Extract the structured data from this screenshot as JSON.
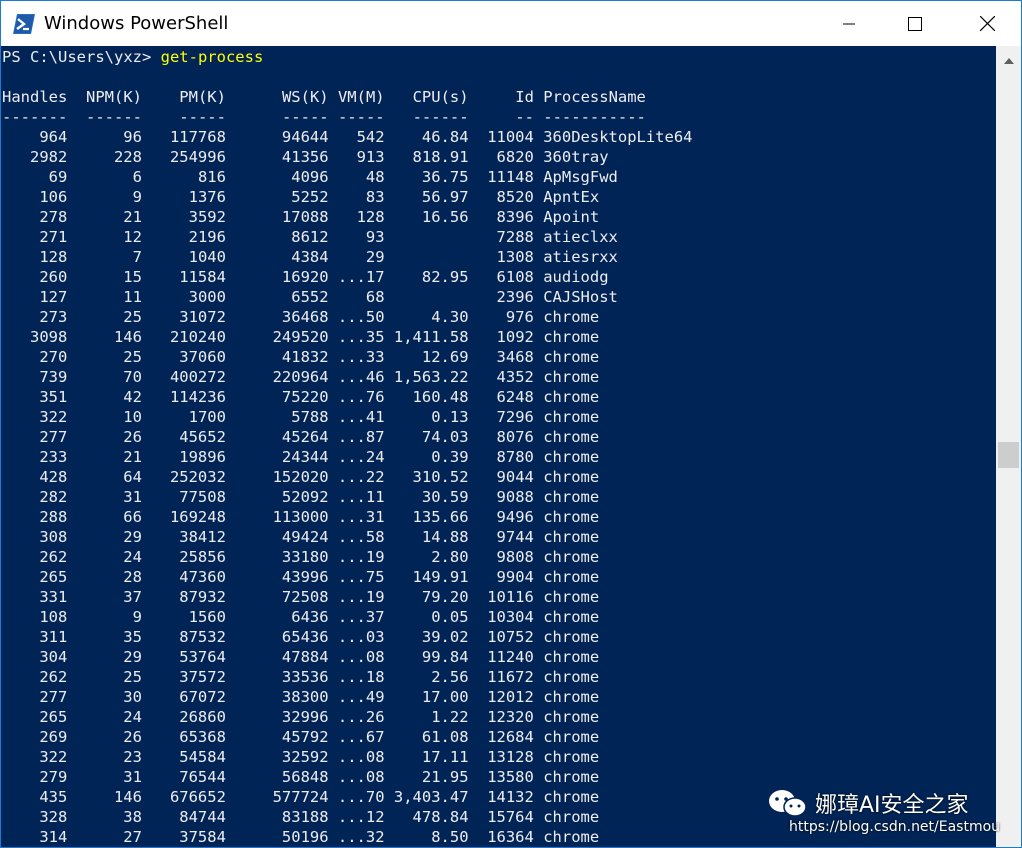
{
  "window": {
    "title": "Windows PowerShell",
    "controls": {
      "minimize": "minimize-icon",
      "maximize": "maximize-icon",
      "close": "close-icon"
    }
  },
  "console": {
    "prompt": "PS C:\\Users\\yxz> ",
    "command": "get-process",
    "header": "Handles  NPM(K)    PM(K)      WS(K) VM(M)   CPU(s)     Id ProcessName",
    "separator": "-------  ------    -----      ----- -----   ------     -- -----------",
    "rows": [
      {
        "handles": "964",
        "npm": "96",
        "pm": "117768",
        "ws": "94644",
        "vm": "542",
        "cpu": "46.84",
        "id": "11004",
        "name": "360DesktopLite64"
      },
      {
        "handles": "2982",
        "npm": "228",
        "pm": "254996",
        "ws": "41356",
        "vm": "913",
        "cpu": "818.91",
        "id": "6820",
        "name": "360tray"
      },
      {
        "handles": "69",
        "npm": "6",
        "pm": "816",
        "ws": "4096",
        "vm": "48",
        "cpu": "36.75",
        "id": "11148",
        "name": "ApMsgFwd"
      },
      {
        "handles": "106",
        "npm": "9",
        "pm": "1376",
        "ws": "5252",
        "vm": "83",
        "cpu": "56.97",
        "id": "8520",
        "name": "ApntEx"
      },
      {
        "handles": "278",
        "npm": "21",
        "pm": "3592",
        "ws": "17088",
        "vm": "128",
        "cpu": "16.56",
        "id": "8396",
        "name": "Apoint"
      },
      {
        "handles": "271",
        "npm": "12",
        "pm": "2196",
        "ws": "8612",
        "vm": "93",
        "cpu": "",
        "id": "7288",
        "name": "atieclxx"
      },
      {
        "handles": "128",
        "npm": "7",
        "pm": "1040",
        "ws": "4384",
        "vm": "29",
        "cpu": "",
        "id": "1308",
        "name": "atiesrxx"
      },
      {
        "handles": "260",
        "npm": "15",
        "pm": "11584",
        "ws": "16920",
        "vm": "...17",
        "cpu": "82.95",
        "id": "6108",
        "name": "audiodg"
      },
      {
        "handles": "127",
        "npm": "11",
        "pm": "3000",
        "ws": "6552",
        "vm": "68",
        "cpu": "",
        "id": "2396",
        "name": "CAJSHost"
      },
      {
        "handles": "273",
        "npm": "25",
        "pm": "31072",
        "ws": "36468",
        "vm": "...50",
        "cpu": "4.30",
        "id": "976",
        "name": "chrome"
      },
      {
        "handles": "3098",
        "npm": "146",
        "pm": "210240",
        "ws": "249520",
        "vm": "...35",
        "cpu": "1,411.58",
        "id": "1092",
        "name": "chrome"
      },
      {
        "handles": "270",
        "npm": "25",
        "pm": "37060",
        "ws": "41832",
        "vm": "...33",
        "cpu": "12.69",
        "id": "3468",
        "name": "chrome"
      },
      {
        "handles": "739",
        "npm": "70",
        "pm": "400272",
        "ws": "220964",
        "vm": "...46",
        "cpu": "1,563.22",
        "id": "4352",
        "name": "chrome"
      },
      {
        "handles": "351",
        "npm": "42",
        "pm": "114236",
        "ws": "75220",
        "vm": "...76",
        "cpu": "160.48",
        "id": "6248",
        "name": "chrome"
      },
      {
        "handles": "322",
        "npm": "10",
        "pm": "1700",
        "ws": "5788",
        "vm": "...41",
        "cpu": "0.13",
        "id": "7296",
        "name": "chrome"
      },
      {
        "handles": "277",
        "npm": "26",
        "pm": "45652",
        "ws": "45264",
        "vm": "...87",
        "cpu": "74.03",
        "id": "8076",
        "name": "chrome"
      },
      {
        "handles": "233",
        "npm": "21",
        "pm": "19896",
        "ws": "24344",
        "vm": "...24",
        "cpu": "0.39",
        "id": "8780",
        "name": "chrome"
      },
      {
        "handles": "428",
        "npm": "64",
        "pm": "252032",
        "ws": "152020",
        "vm": "...22",
        "cpu": "310.52",
        "id": "9044",
        "name": "chrome"
      },
      {
        "handles": "282",
        "npm": "31",
        "pm": "77508",
        "ws": "52092",
        "vm": "...11",
        "cpu": "30.59",
        "id": "9088",
        "name": "chrome"
      },
      {
        "handles": "288",
        "npm": "66",
        "pm": "169248",
        "ws": "113000",
        "vm": "...31",
        "cpu": "135.66",
        "id": "9496",
        "name": "chrome"
      },
      {
        "handles": "308",
        "npm": "29",
        "pm": "38412",
        "ws": "49424",
        "vm": "...58",
        "cpu": "14.88",
        "id": "9744",
        "name": "chrome"
      },
      {
        "handles": "262",
        "npm": "24",
        "pm": "25856",
        "ws": "33180",
        "vm": "...19",
        "cpu": "2.80",
        "id": "9808",
        "name": "chrome"
      },
      {
        "handles": "265",
        "npm": "28",
        "pm": "47360",
        "ws": "43996",
        "vm": "...75",
        "cpu": "149.91",
        "id": "9904",
        "name": "chrome"
      },
      {
        "handles": "331",
        "npm": "37",
        "pm": "87932",
        "ws": "72508",
        "vm": "...19",
        "cpu": "79.20",
        "id": "10116",
        "name": "chrome"
      },
      {
        "handles": "108",
        "npm": "9",
        "pm": "1560",
        "ws": "6436",
        "vm": "...37",
        "cpu": "0.05",
        "id": "10304",
        "name": "chrome"
      },
      {
        "handles": "311",
        "npm": "35",
        "pm": "87532",
        "ws": "65436",
        "vm": "...03",
        "cpu": "39.02",
        "id": "10752",
        "name": "chrome"
      },
      {
        "handles": "304",
        "npm": "29",
        "pm": "53764",
        "ws": "47884",
        "vm": "...08",
        "cpu": "99.84",
        "id": "11240",
        "name": "chrome"
      },
      {
        "handles": "262",
        "npm": "25",
        "pm": "37572",
        "ws": "33536",
        "vm": "...18",
        "cpu": "2.56",
        "id": "11672",
        "name": "chrome"
      },
      {
        "handles": "277",
        "npm": "30",
        "pm": "67072",
        "ws": "38300",
        "vm": "...49",
        "cpu": "17.00",
        "id": "12012",
        "name": "chrome"
      },
      {
        "handles": "265",
        "npm": "24",
        "pm": "26860",
        "ws": "32996",
        "vm": "...26",
        "cpu": "1.22",
        "id": "12320",
        "name": "chrome"
      },
      {
        "handles": "269",
        "npm": "26",
        "pm": "65368",
        "ws": "45792",
        "vm": "...67",
        "cpu": "61.08",
        "id": "12684",
        "name": "chrome"
      },
      {
        "handles": "322",
        "npm": "23",
        "pm": "54584",
        "ws": "32592",
        "vm": "...08",
        "cpu": "17.11",
        "id": "13128",
        "name": "chrome"
      },
      {
        "handles": "279",
        "npm": "31",
        "pm": "76544",
        "ws": "56848",
        "vm": "...08",
        "cpu": "21.95",
        "id": "13580",
        "name": "chrome"
      },
      {
        "handles": "435",
        "npm": "146",
        "pm": "676652",
        "ws": "577724",
        "vm": "...70",
        "cpu": "3,403.47",
        "id": "14132",
        "name": "chrome"
      },
      {
        "handles": "328",
        "npm": "38",
        "pm": "84744",
        "ws": "83188",
        "vm": "...12",
        "cpu": "478.84",
        "id": "15764",
        "name": "chrome"
      },
      {
        "handles": "314",
        "npm": "27",
        "pm": "37584",
        "ws": "50196",
        "vm": "...32",
        "cpu": "8.50",
        "id": "16364",
        "name": "chrome"
      }
    ]
  },
  "watermark": {
    "brand": "娜璋AI安全之家",
    "url": "https://blog.csdn.net/Eastmou"
  },
  "colors": {
    "console_bg": "#012456",
    "console_fg": "#eeedf0",
    "command": "#ffff00",
    "window_border": "#1a7ad4"
  }
}
